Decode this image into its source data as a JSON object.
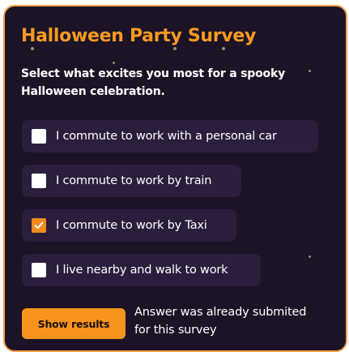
{
  "survey": {
    "title": "Halloween Party Survey",
    "subtitle": "Select what excites you most for a spooky Halloween celebration.",
    "options": [
      {
        "label": "I commute to work with a personal car",
        "checked": false
      },
      {
        "label": "I commute to work by train",
        "checked": false
      },
      {
        "label": "I commute to work by Taxi",
        "checked": true
      },
      {
        "label": "I live nearby and walk to work",
        "checked": false
      }
    ],
    "show_results_label": "Show results",
    "notice": "Answer was already submited for this survey"
  },
  "colors": {
    "card_background": "#1c1326",
    "card_border": "#f2a14a",
    "title": "#f89a23",
    "option_background": "#2a1e3c",
    "checkbox_checked": "#f08a1c",
    "button": "#f7941d"
  }
}
